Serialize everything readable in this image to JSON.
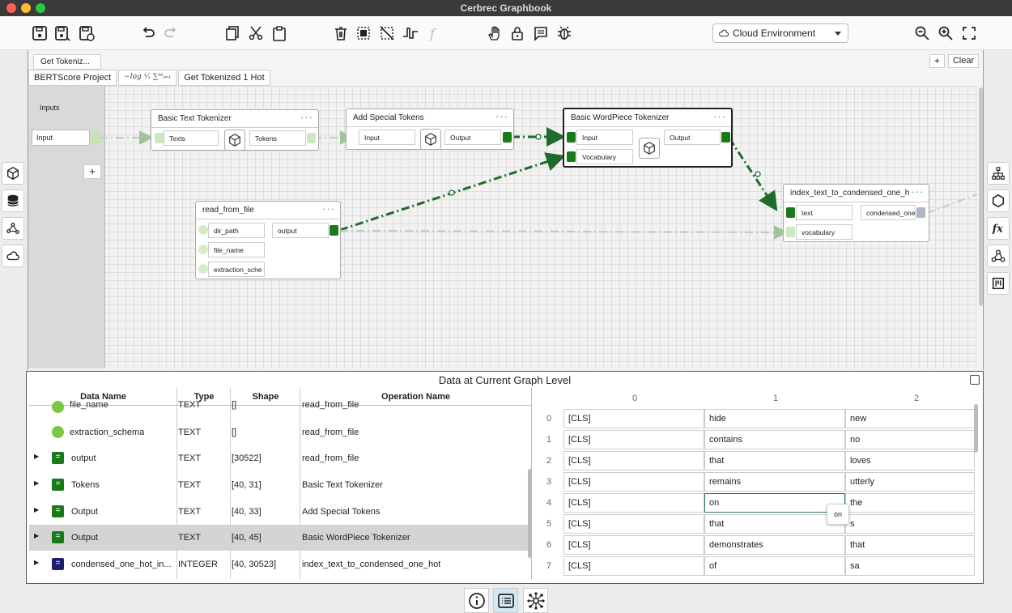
{
  "window": {
    "title": "Cerbrec Graphbook"
  },
  "toolbar": {
    "environment": "Cloud Environment",
    "icons": [
      "save-icon",
      "save-as-icon",
      "export-icon",
      "undo-icon",
      "redo-icon",
      "copy-icon",
      "cut-icon",
      "paste-icon",
      "delete-icon",
      "select-icon",
      "deselect-icon",
      "step-function-icon",
      "function-icon",
      "hand-icon",
      "lock-icon",
      "comment-icon",
      "debug-icon",
      "zoom-out-icon",
      "zoom-in-icon",
      "fit-screen-icon"
    ]
  },
  "graph": {
    "tab": "Get Tokeniz...",
    "plus": "+",
    "clear": "Clear",
    "breadcrumbs": [
      "BERTScore Project",
      "−log ¹⁄ₓ ∑ᴹᵢ₌₁",
      "Get Tokenized 1 Hot"
    ],
    "inputs_label": "Inputs",
    "input_field": "Input",
    "add": "+",
    "nodes": {
      "basic_text": {
        "title": "Basic Text Tokenizer",
        "in": "Texts",
        "out": "Tokens"
      },
      "special": {
        "title": "Add Special Tokens",
        "in": "Input",
        "out": "Output"
      },
      "wordpiece": {
        "title": "Basic WordPiece Tokenizer",
        "in1": "Input",
        "in2": "Vocabulary",
        "out": "Output"
      },
      "read_file": {
        "title": "read_from_file",
        "in1": "dir_path",
        "in2": "file_name",
        "in3": "extraction_sche",
        "out": "output"
      },
      "index_text": {
        "title": "index_text_to_condensed_one_h",
        "in1": "text",
        "in2": "vocabulary",
        "out": "condensed_one"
      }
    }
  },
  "data_panel": {
    "title": "Data at Current Graph Level",
    "columns": [
      "Data Name",
      "Type",
      "Shape",
      "Operation Name"
    ],
    "rows": [
      {
        "name": "file_name",
        "type": "TEXT",
        "shape": "[]",
        "op": "read_from_file"
      },
      {
        "name": "extraction_schema",
        "type": "TEXT",
        "shape": "[]",
        "op": "read_from_file"
      },
      {
        "name": "output",
        "type": "TEXT",
        "shape": "[30522]",
        "op": "read_from_file"
      },
      {
        "name": "Tokens",
        "type": "TEXT",
        "shape": "[40, 31]",
        "op": "Basic Text Tokenizer"
      },
      {
        "name": "Output",
        "type": "TEXT",
        "shape": "[40, 33]",
        "op": "Add Special Tokens"
      },
      {
        "name": "Output",
        "type": "TEXT",
        "shape": "[40, 45]",
        "op": "Basic WordPiece Tokenizer"
      },
      {
        "name": "condensed_one_hot_in...",
        "type": "INTEGER",
        "shape": "[40, 30523]",
        "op": "index_text_to_condensed_one_hot"
      }
    ],
    "grid": {
      "col_headers": [
        "0",
        "1",
        "2"
      ],
      "row_headers": [
        "0",
        "1",
        "2",
        "3",
        "4",
        "5",
        "6",
        "7"
      ],
      "cells": [
        [
          "[CLS]",
          "hide",
          "new"
        ],
        [
          "[CLS]",
          "contains",
          "no"
        ],
        [
          "[CLS]",
          "that",
          "loves"
        ],
        [
          "[CLS]",
          "remains",
          "utterly"
        ],
        [
          "[CLS]",
          "on",
          "the"
        ],
        [
          "[CLS]",
          "that",
          "s"
        ],
        [
          "[CLS]",
          "demonstrates",
          "that"
        ],
        [
          "[CLS]",
          "of",
          "sa"
        ]
      ],
      "tooltip": "on"
    }
  },
  "bottom": {
    "icons": [
      "info-icon",
      "list-icon",
      "network-icon"
    ]
  }
}
